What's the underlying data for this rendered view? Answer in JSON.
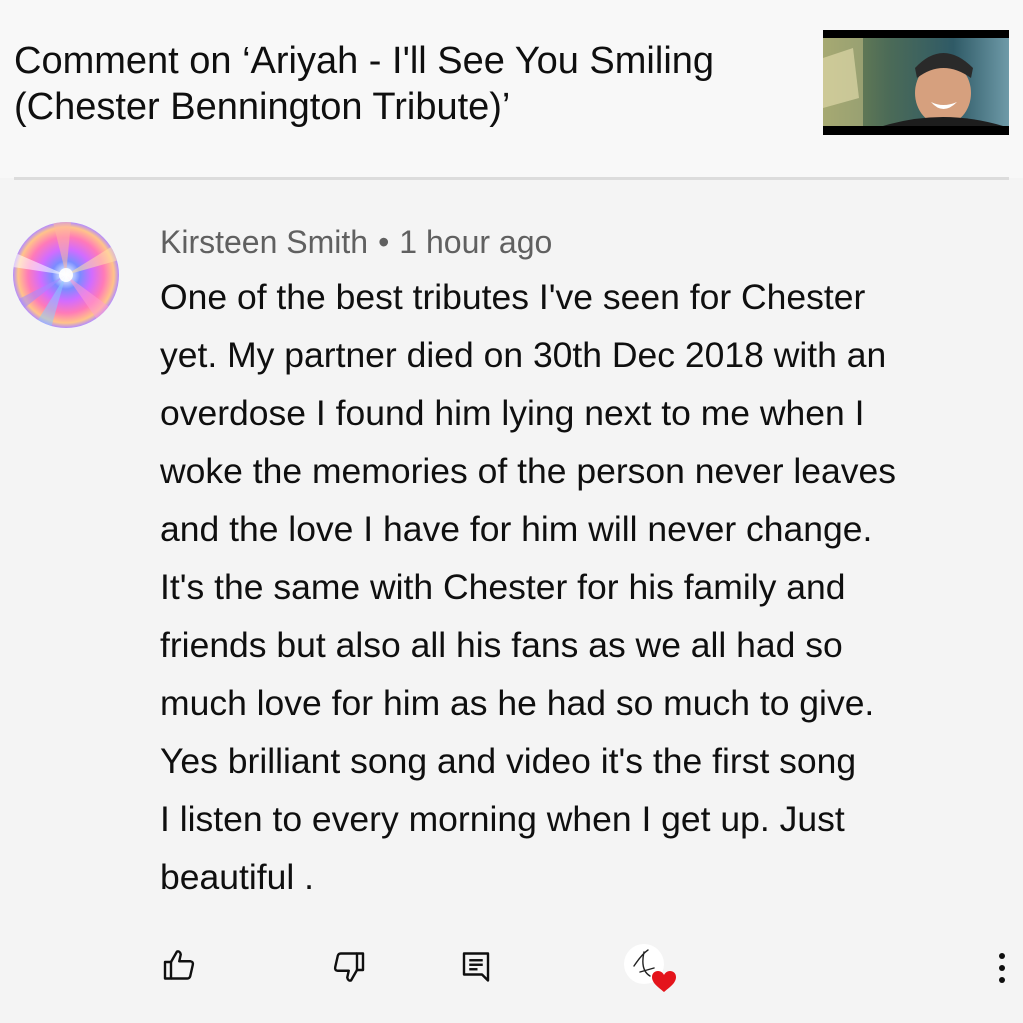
{
  "header": {
    "title": "Comment on ‘Ariyah - I'll See You Smiling (Chester Bennington Tribute)’",
    "thumbnail_icon": "video-thumbnail"
  },
  "comment": {
    "author": "Kirsteen Smith",
    "separator": "•",
    "time": "1 hour ago",
    "avatar_icon": "avatar-image",
    "text_lines": [
      "One of the best tributes I've seen for Chester",
      "yet. My partner died on 30th Dec 2018 with an",
      "overdose I found him lying next to me when I",
      "woke the memories of the person never leaves",
      "and the love I have for him will never change.",
      "It's the same with Chester for his family and",
      "friends but also all his fans as we all had so",
      "much love for him as he had so much to give.",
      "Yes brilliant song and video it's the first song",
      "I listen to every morning when I get up. Just",
      "beautiful ."
    ]
  },
  "actions": {
    "like_icon": "thumbs-up-icon",
    "dislike_icon": "thumbs-down-icon",
    "reply_icon": "reply-icon",
    "creator_heart_icon": "creator-heart-icon",
    "more_icon": "more-vert-icon",
    "heart_color": "#e4141b"
  }
}
